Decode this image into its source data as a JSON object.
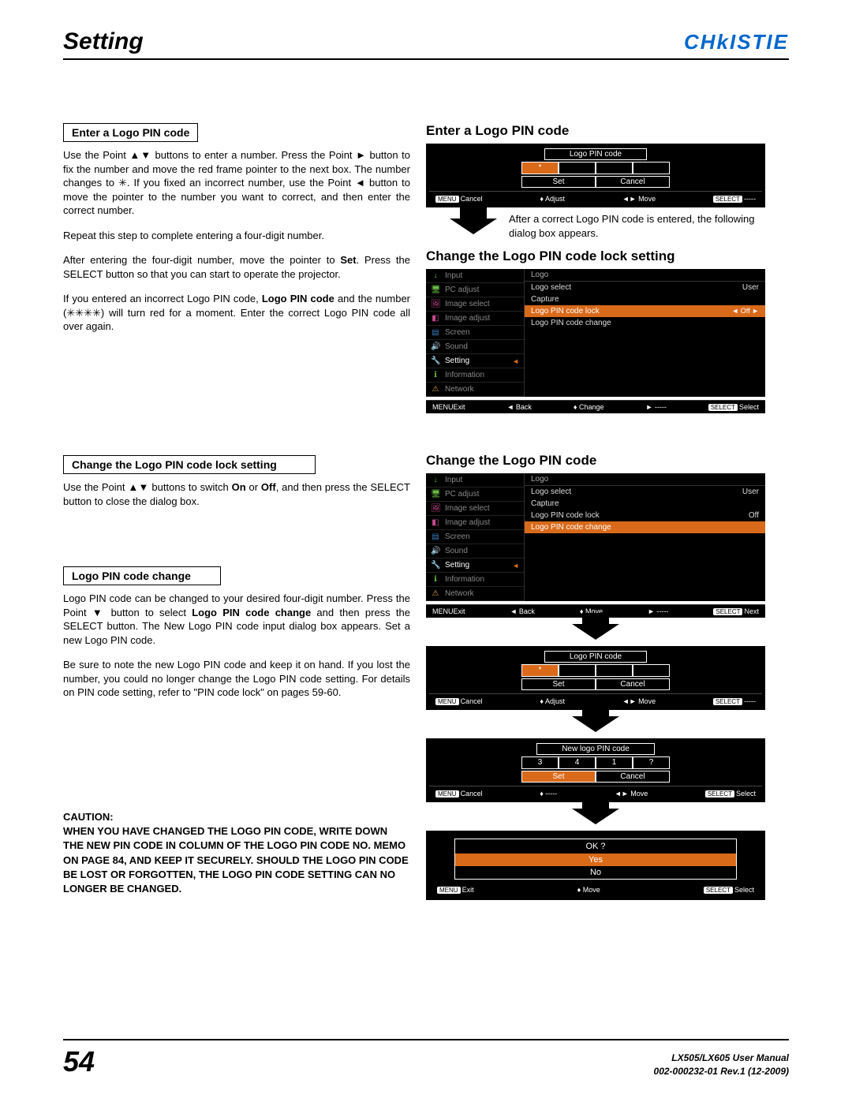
{
  "header": {
    "title": "Setting",
    "brand": "CHkISTIE"
  },
  "left": {
    "sec1_title": "Enter a Logo PIN code",
    "sec1_p1": "Use the Point ▲▼ buttons to enter a number. Press the Point ► button to fix the number and move the red frame pointer to the next box. The number changes to ✳. If you fixed an incorrect number, use the Point ◄ button to move the pointer to the number you want to correct, and then enter the correct number.",
    "sec1_p2": "Repeat this step to complete entering a four-digit number.",
    "sec1_p3_a": "After entering the four-digit number, move the pointer to ",
    "sec1_p3_b": "Set",
    "sec1_p3_c": ". Press the SELECT button so that you can start to operate the projector.",
    "sec1_p4_a": "If you entered an incorrect Logo PIN code, ",
    "sec1_p4_b": "Logo PIN code",
    "sec1_p4_c": " and the number (✳✳✳✳) will turn red for a moment. Enter the correct Logo PIN code all over again.",
    "sec2_title": "Change the Logo PIN code lock setting",
    "sec2_p1_a": "Use the Point ▲▼ buttons to switch ",
    "sec2_p1_b": "On",
    "sec2_p1_c": " or ",
    "sec2_p1_d": "Off",
    "sec2_p1_e": ", and then press the SELECT button to close the dialog box.",
    "sec3_title": "Logo PIN code change",
    "sec3_p1_a": "Logo PIN code can be changed to your desired four-digit number. Press the Point ▼ button to select ",
    "sec3_p1_b": "Logo PIN code change",
    "sec3_p1_c": " and then press the SELECT button. The New Logo PIN code input dialog box appears. Set a new Logo PIN code.",
    "sec3_p2": "Be sure to note the new Logo PIN code and keep it on hand. If you lost the number, you could no longer change the Logo PIN code setting. For details on PIN code setting, refer to \"PIN code lock\" on pages 59-60.",
    "caution_label": "CAUTION:",
    "caution_text": "WHEN YOU HAVE CHANGED THE LOGO PIN CODE, WRITE DOWN THE NEW PIN CODE IN COLUMN OF THE LOGO PIN CODE NO. MEMO ON PAGE 84, AND KEEP IT SECURELY. SHOULD THE LOGO PIN CODE BE LOST OR FORGOTTEN, THE LOGO PIN CODE SETTING CAN NO LONGER BE CHANGED."
  },
  "right": {
    "h1": "Enter a Logo PIN code",
    "h2": "Change the Logo PIN code lock setting",
    "h3": "Change the Logo PIN code",
    "arrow_text": "After a correct Logo PIN code is entered, the following dialog box appears."
  },
  "osd1": {
    "title": "Logo PIN code",
    "star": "*",
    "set": "Set",
    "cancel": "Cancel",
    "f1": "Cancel",
    "f2": "Adjust",
    "f3": "Move",
    "f4": "-----"
  },
  "menu": {
    "items": [
      "Input",
      "PC adjust",
      "Image select",
      "Image adjust",
      "Screen",
      "Sound",
      "Setting",
      "Information",
      "Network"
    ],
    "icons": [
      "↓",
      "🖥",
      "🖼",
      "◧",
      "▤",
      "🔊",
      "🔧",
      "ℹ",
      "⚠"
    ],
    "colors": [
      "#6bbd45",
      "#6bbd45",
      "#c94a8f",
      "#c94a8f",
      "#3a7bbd",
      "#3a7bbd",
      "#c94a8f",
      "#6bbd45",
      "#d9a441"
    ],
    "header": "Logo",
    "r_items": [
      "Logo select",
      "Capture",
      "Logo PIN code lock",
      "Logo PIN code change"
    ],
    "user": "User",
    "off": "Off",
    "exit": "Exit",
    "back": "Back",
    "change": "Change",
    "move": "Move",
    "dashes": "-----",
    "select": "Select",
    "next": "Next"
  },
  "osd3": {
    "title": "New logo PIN code",
    "d1": "3",
    "d2": "4",
    "d3": "1",
    "d4": "?",
    "set": "Set",
    "cancel": "Cancel"
  },
  "ok": {
    "title": "OK ?",
    "yes": "Yes",
    "no": "No"
  },
  "footer": {
    "page": "54",
    "line1": "LX505/LX605 User Manual",
    "line2": "002-000232-01 Rev.1 (12-2009)"
  },
  "badges": {
    "menu": "MENU",
    "select": "SELECT"
  }
}
